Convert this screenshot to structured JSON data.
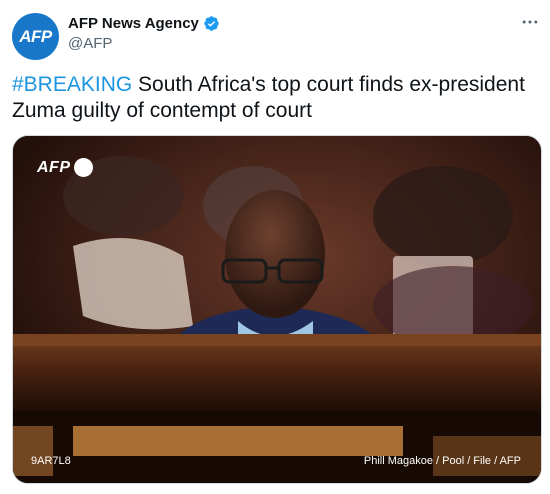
{
  "author": {
    "avatar_text": "AFP",
    "display_name": "AFP News Agency",
    "handle": "@AFP",
    "verified": true,
    "avatar_color": "#1877c9"
  },
  "tweet": {
    "hashtag": "#BREAKING",
    "text": " South Africa's top court finds ex-president Zuma guilty of contempt of court",
    "hashtag_color": "#1b95e0"
  },
  "media": {
    "logo_text": "AFP",
    "photo_id": "9AR7L8",
    "credit": "Phill Magakoe / Pool / File / AFP"
  },
  "icons": {
    "more": "more-options-icon",
    "verified": "verified-badge-icon"
  }
}
